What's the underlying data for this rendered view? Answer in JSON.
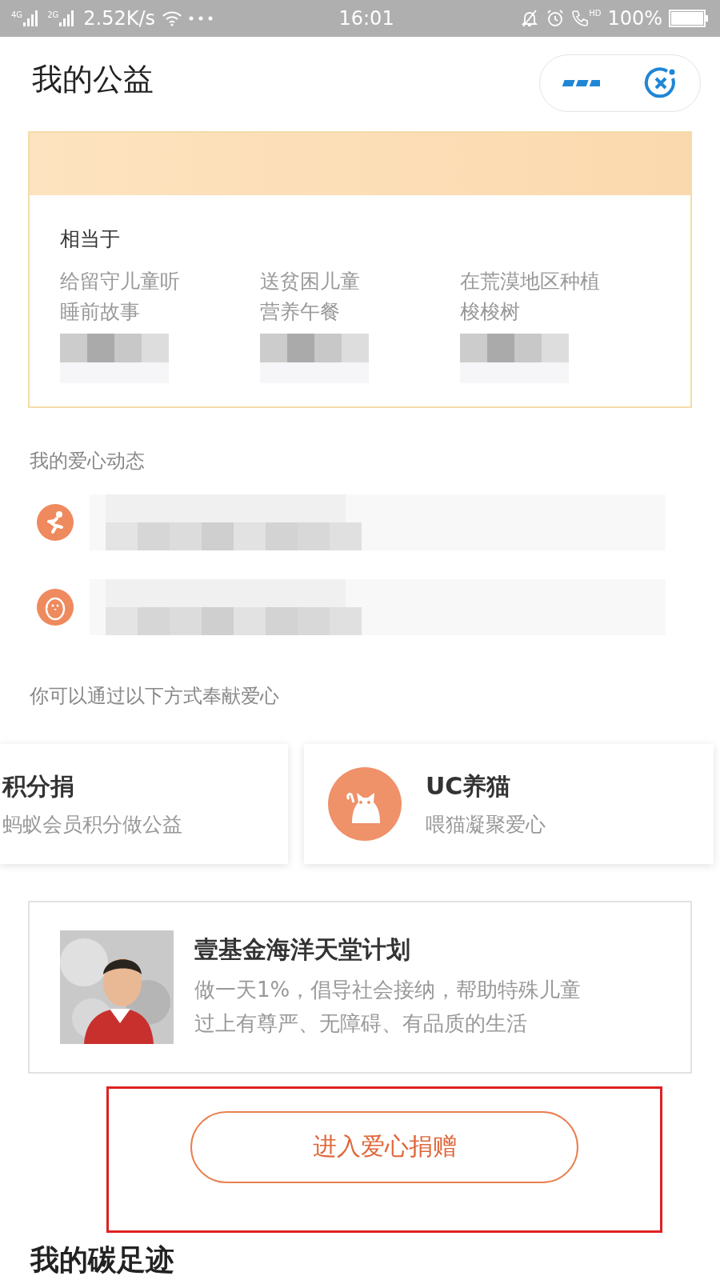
{
  "status_bar": {
    "signals": [
      "4G",
      "2G"
    ],
    "speed": "2.52K/s",
    "time": "16:01",
    "call_badge": "HD",
    "battery": "100%"
  },
  "header": {
    "title": "我的公益"
  },
  "equivalent": {
    "label": "相当于",
    "items": [
      {
        "lines": [
          "给留守儿童听",
          "睡前故事"
        ]
      },
      {
        "lines": [
          "送贫困儿童",
          "营养午餐"
        ]
      },
      {
        "lines": [
          "在荒漠地区种植",
          "梭梭树"
        ]
      }
    ]
  },
  "activity": {
    "title": "我的爱心动态",
    "rows": [
      {
        "kind": "runner"
      },
      {
        "kind": "chick"
      }
    ]
  },
  "ways": {
    "title": "你可以通过以下方式奉献爱心",
    "cards": [
      {
        "kind": "plain",
        "title": "积分捐",
        "subtitle": "蚂蚁会员积分做公益"
      },
      {
        "kind": "cat",
        "title": "UC养猫",
        "subtitle": "喂猫凝聚爱心"
      }
    ]
  },
  "project": {
    "title": "壹基金海洋天堂计划",
    "description": "做一天1%，倡导社会接纳，帮助特殊儿童过上有尊严、无障碍、有品质的生活",
    "button": "进入爱心捐赠"
  },
  "footprint": {
    "title": "我的碳足迹"
  }
}
